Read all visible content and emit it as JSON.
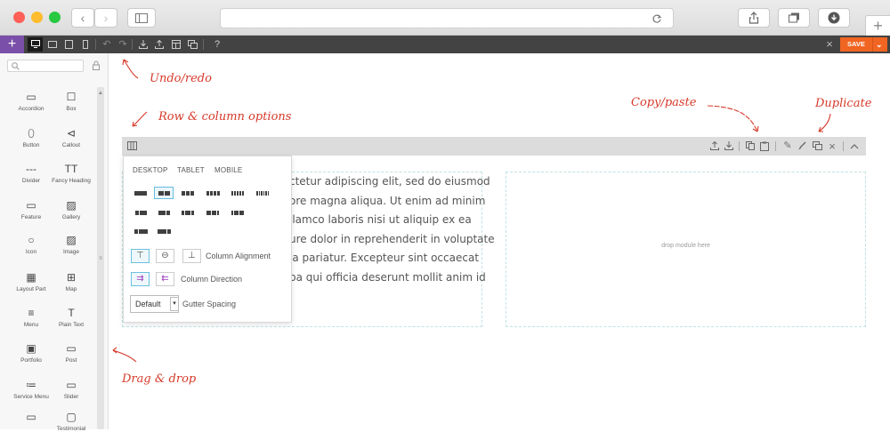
{
  "browser": {
    "lights": [
      "#ff5f57",
      "#febc2e",
      "#28c840"
    ],
    "back_icon": "chevron-left",
    "forward_icon": "chevron-right",
    "sidebar_toggle_icon": "sidebar-icon",
    "reload_icon": "reload-icon",
    "share_icon": "share-icon",
    "tabs_icon": "tabs-icon",
    "download_icon": "download-icon",
    "newtab_label": "+"
  },
  "toolbar": {
    "add_label": "+",
    "close_label": "×",
    "save_label": "SAVE",
    "help_label": "?",
    "colors": {
      "bg": "#434343",
      "accent": "#7a4fa9",
      "save": "#f06522"
    }
  },
  "annotations": {
    "undo_redo": "Undo/redo",
    "row_options": "Row & column options",
    "copy_paste": "Copy/paste",
    "duplicate": "Duplicate",
    "drag_drop": "Drag & drop"
  },
  "sidebar": {
    "modules": [
      {
        "label": "Accordion",
        "icon": "▭"
      },
      {
        "label": "Box",
        "icon": "☐"
      },
      {
        "label": "Button",
        "icon": "⬯"
      },
      {
        "label": "Callout",
        "icon": "⊲"
      },
      {
        "label": "Divider",
        "icon": "---"
      },
      {
        "label": "Fancy Heading",
        "icon": "TT"
      },
      {
        "label": "Feature",
        "icon": "▭"
      },
      {
        "label": "Gallery",
        "icon": "▨"
      },
      {
        "label": "Icon",
        "icon": "○"
      },
      {
        "label": "Image",
        "icon": "▨"
      },
      {
        "label": "Layout Part",
        "icon": "▦"
      },
      {
        "label": "Map",
        "icon": "⊞"
      },
      {
        "label": "Menu",
        "icon": "≡"
      },
      {
        "label": "Plain Text",
        "icon": "T"
      },
      {
        "label": "Portfolio",
        "icon": "▣"
      },
      {
        "label": "Post",
        "icon": "▭"
      },
      {
        "label": "Service Menu",
        "icon": "≔"
      },
      {
        "label": "Slider",
        "icon": "▭"
      },
      {
        "label": "",
        "icon": "▭"
      },
      {
        "label": "Testimonial",
        "icon": "▢"
      }
    ]
  },
  "panel": {
    "tabs": [
      "DESKTOP",
      "TABLET",
      "MOBILE"
    ],
    "column_alignment": "Column Alignment",
    "column_direction": "Column Direction",
    "gutter_value": "Default",
    "gutter_label": "Gutter Spacing"
  },
  "content": {
    "lines": [
      "ctetur adipiscing elit, sed do eiusmod",
      "ore magna aliqua. Ut enim ad minim",
      "llamco laboris nisi ut aliquip ex ea",
      "ure dolor in reprehenderit in voluptate",
      "la pariatur. Excepteur sint occaecat",
      "pa qui officia deserunt mollit anim id"
    ],
    "drop_text": "drop module here"
  }
}
